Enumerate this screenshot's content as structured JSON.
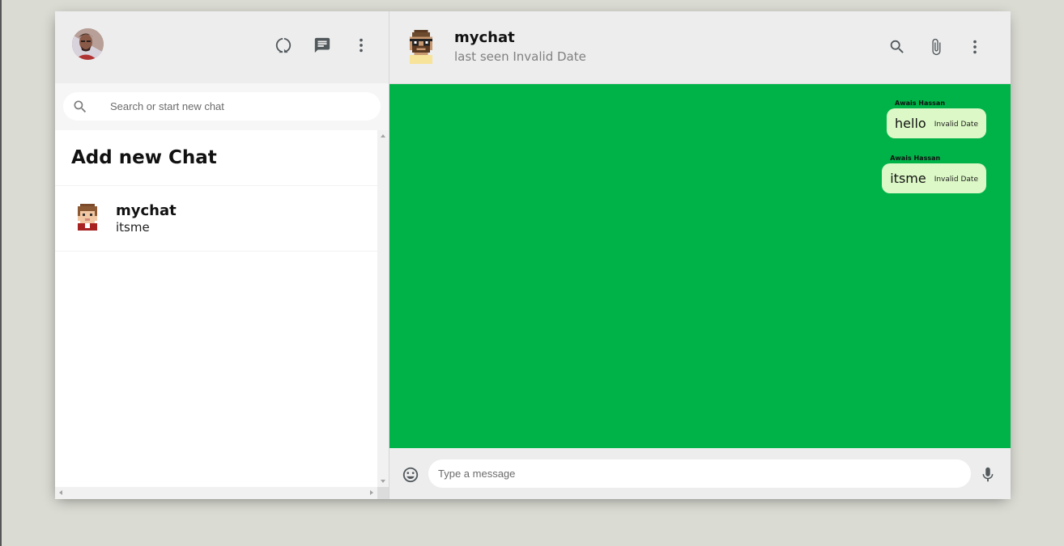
{
  "sidebar": {
    "header": {
      "avatar_icon": "user-avatar",
      "icons": [
        "status-icon",
        "chat-icon",
        "more-vert-icon"
      ]
    },
    "search": {
      "placeholder": "Search or start new chat"
    },
    "add_new_chat": "Add new Chat",
    "chats": [
      {
        "name": "mychat",
        "last_message": "itsme",
        "avatar_icon": "pixel-avatar-icon"
      }
    ]
  },
  "chat": {
    "header": {
      "name": "mychat",
      "status": "last seen Invalid Date",
      "icons": [
        "search-icon",
        "attach-icon",
        "more-vert-icon"
      ]
    },
    "messages": [
      {
        "sender": "Awais Hassan",
        "text": "hello",
        "time": "Invalid Date"
      },
      {
        "sender": "Awais Hassan",
        "text": "itsme",
        "time": "Invalid Date"
      }
    ],
    "footer": {
      "placeholder": "Type a message",
      "icons": [
        "emoji-icon",
        "mic-icon"
      ]
    }
  },
  "colors": {
    "chat_background": "#00b349",
    "bubble": "#dcf8c6",
    "header": "#ededed",
    "page_background": "#dadbd3"
  }
}
